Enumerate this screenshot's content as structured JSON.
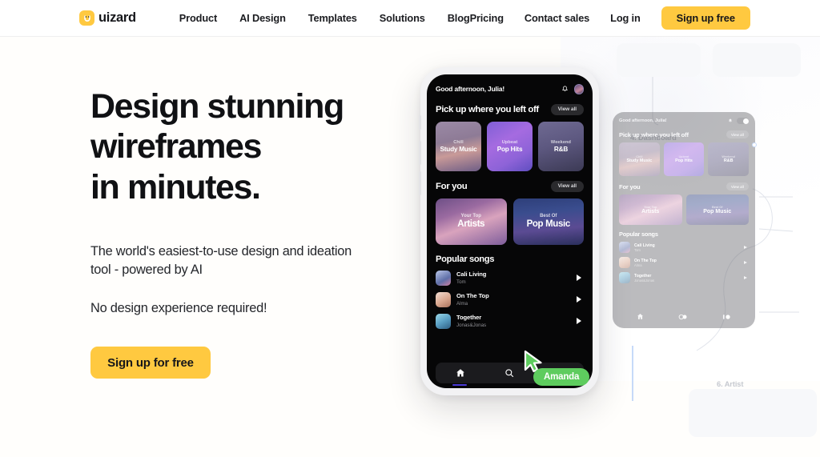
{
  "brand": {
    "name": "uizard",
    "logo_icon": "uizard-smiley-icon",
    "accent": "#FFC940"
  },
  "nav": {
    "left_links": [
      {
        "label": "Product",
        "name": "nav-link-product"
      },
      {
        "label": "AI Design",
        "name": "nav-link-ai-design"
      },
      {
        "label": "Templates",
        "name": "nav-link-templates"
      },
      {
        "label": "Solutions",
        "name": "nav-link-solutions"
      },
      {
        "label": "Blog",
        "name": "nav-link-blog"
      }
    ],
    "right_links": [
      {
        "label": "Pricing",
        "name": "nav-link-pricing"
      },
      {
        "label": "Contact sales",
        "name": "nav-link-contact-sales"
      },
      {
        "label": "Log in",
        "name": "nav-link-login"
      }
    ],
    "cta_label": "Sign up free"
  },
  "hero": {
    "heading_line1": "Design stunning",
    "heading_line2": "wireframes",
    "heading_line3": "in minutes.",
    "subheading": "The world's easiest-to-use design and ideation tool - powered by AI",
    "note": "No design experience required!",
    "cta_label": "Sign up for free"
  },
  "phone": {
    "greeting": "Good afternoon, Julia!",
    "bell_icon": "bell-icon",
    "avatar_icon": "user-avatar",
    "section1": {
      "title": "Pick up where you left off",
      "view_all": "View all"
    },
    "cards_small": [
      {
        "sub": "Chill",
        "main": "Study Music",
        "color": "#9b8aa6"
      },
      {
        "sub": "Upbeat",
        "main": "Pop Hits",
        "color": "#8e63d8"
      },
      {
        "sub": "Weekend",
        "main": "R&B",
        "color": "#5d5880"
      }
    ],
    "section2": {
      "title": "For you",
      "view_all": "View all"
    },
    "cards_large": [
      {
        "sub": "Your Top",
        "main": "Artists",
        "color": "#9a6aa0"
      },
      {
        "sub": "Best Of",
        "main": "Pop Music",
        "color": "#3a4d8e"
      }
    ],
    "section3": {
      "title": "Popular songs"
    },
    "songs": [
      {
        "name": "Cali Living",
        "artist": "Tom",
        "play_icon": "play-icon"
      },
      {
        "name": "On The Top",
        "artist": "Alma",
        "play_icon": "play-icon"
      },
      {
        "name": "Together",
        "artist": "Jonas&Jonas",
        "play_icon": "play-icon"
      }
    ],
    "tabbar": [
      {
        "icon": "home-icon",
        "name": "tab-home"
      },
      {
        "icon": "search-icon",
        "name": "tab-search"
      },
      {
        "icon": "library-icon",
        "name": "tab-library"
      }
    ]
  },
  "ghost_phone": {
    "frame_label": "4. Dashboard",
    "frame_label_2": "6. Artist",
    "greeting": "Good afternoon, Julia!",
    "section1": {
      "title": "Pick up where you left off",
      "view_all": "View all"
    },
    "cards_small": [
      {
        "sub": "Chill",
        "main": "Study Music"
      },
      {
        "sub": "Upbeat",
        "main": "Pop Hits"
      },
      {
        "sub": "Weekend",
        "main": "R&B"
      }
    ],
    "section2": {
      "title": "For you",
      "view_all": "View all"
    },
    "cards_large": [
      {
        "sub": "Your Top",
        "main": "Artists"
      },
      {
        "sub": "Best Of",
        "main": "Pop Music"
      }
    ],
    "section3": {
      "title": "Popular songs"
    },
    "songs": [
      {
        "name": "Cali Living",
        "artist": "Tom"
      },
      {
        "name": "On The Top",
        "artist": "Alma"
      },
      {
        "name": "Together",
        "artist": "Jonas&Jonas"
      }
    ]
  },
  "cursor": {
    "label": "Amanda",
    "color": "#5ECC5E",
    "icon": "cursor-arrow-icon"
  }
}
